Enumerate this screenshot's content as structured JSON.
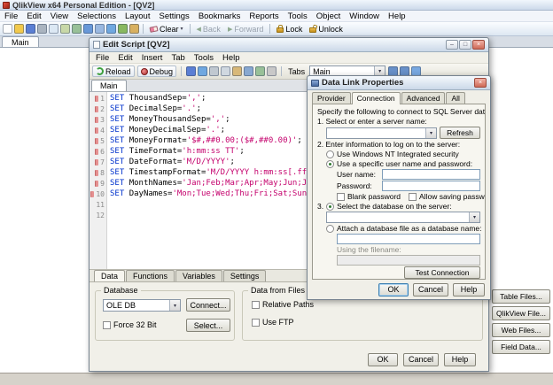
{
  "app": {
    "title": "QlikView x64 Personal Edition - [QV2]",
    "menu": [
      "File",
      "Edit",
      "View",
      "Selections",
      "Layout",
      "Settings",
      "Bookmarks",
      "Reports",
      "Tools",
      "Object",
      "Window",
      "Help"
    ],
    "toolbar": {
      "icons": [
        {
          "name": "new-file-icon",
          "color": "#fdfdfd"
        },
        {
          "name": "open-icon",
          "color": "#f2c94c"
        },
        {
          "name": "save-icon",
          "color": "#5b7fd4"
        },
        {
          "name": "print-icon",
          "color": "#aab4c0"
        },
        {
          "name": "print-preview-icon",
          "color": "#dce8f4"
        },
        {
          "name": "edit-script-icon",
          "color": "#c8d8a8"
        },
        {
          "name": "table-viewer-icon",
          "color": "#98c098"
        },
        {
          "name": "undo-icon",
          "color": "#6898d8"
        },
        {
          "name": "redo-icon",
          "color": "#9ab8e0"
        },
        {
          "name": "search-icon",
          "color": "#70a8e0"
        },
        {
          "name": "current-selections-icon",
          "color": "#88b860"
        },
        {
          "name": "bookmark-icon",
          "color": "#d8b060"
        }
      ],
      "clear_label": "Clear",
      "back_label": "Back",
      "forward_label": "Forward",
      "lock_label": "Lock",
      "unlock_label": "Unlock"
    },
    "sheet_tab": "Main"
  },
  "edit_script": {
    "title": "Edit Script [QV2]",
    "menu": [
      "File",
      "Edit",
      "Insert",
      "Tab",
      "Tools",
      "Help"
    ],
    "toolbar": {
      "reload_label": "Reload",
      "debug_label": "Debug",
      "icons": [
        {
          "name": "save-icon",
          "color": "#5b7fd4"
        },
        {
          "name": "search-icon",
          "color": "#70a8e0"
        },
        {
          "name": "cut-icon",
          "color": "#c0c8d0"
        },
        {
          "name": "copy-icon",
          "color": "#d0d8e0"
        },
        {
          "name": "paste-icon",
          "color": "#d8b878"
        },
        {
          "name": "find-replace-icon",
          "color": "#88a8d0"
        },
        {
          "name": "syntax-check-icon",
          "color": "#98c098"
        },
        {
          "name": "comment-icon",
          "color": "#c8c8c8"
        }
      ],
      "tabs_label": "Tabs",
      "tab_combo_value": "Main",
      "right_icons": [
        {
          "name": "promote-tab-icon",
          "color": "#6890c8"
        },
        {
          "name": "demote-tab-icon",
          "color": "#6890c8"
        },
        {
          "name": "help-icon",
          "color": "#78a8e0"
        }
      ]
    },
    "script_tab": "Main",
    "editor": {
      "line_count": 12,
      "lines": [
        [
          [
            "kw",
            "SET "
          ],
          [
            "id",
            "ThousandSep"
          ],
          [
            "op",
            "="
          ],
          [
            "str",
            "','"
          ],
          [
            "pn",
            ";"
          ]
        ],
        [
          [
            "kw",
            "SET "
          ],
          [
            "id",
            "DecimalSep"
          ],
          [
            "op",
            "="
          ],
          [
            "str",
            "'.'"
          ],
          [
            "pn",
            ";"
          ]
        ],
        [
          [
            "kw",
            "SET "
          ],
          [
            "id",
            "MoneyThousandSep"
          ],
          [
            "op",
            "="
          ],
          [
            "str",
            "','"
          ],
          [
            "pn",
            ";"
          ]
        ],
        [
          [
            "kw",
            "SET "
          ],
          [
            "id",
            "MoneyDecimalSep"
          ],
          [
            "op",
            "="
          ],
          [
            "str",
            "'.'"
          ],
          [
            "pn",
            ";"
          ]
        ],
        [
          [
            "kw",
            "SET "
          ],
          [
            "id",
            "MoneyFormat"
          ],
          [
            "op",
            "="
          ],
          [
            "str",
            "'$#,##0.00;($#,##0.00)'"
          ],
          [
            "pn",
            ";"
          ]
        ],
        [
          [
            "kw",
            "SET "
          ],
          [
            "id",
            "TimeFormat"
          ],
          [
            "op",
            "="
          ],
          [
            "str",
            "'h:mm:ss TT'"
          ],
          [
            "pn",
            ";"
          ]
        ],
        [
          [
            "kw",
            "SET "
          ],
          [
            "id",
            "DateFormat"
          ],
          [
            "op",
            "="
          ],
          [
            "str",
            "'M/D/YYYY'"
          ],
          [
            "pn",
            ";"
          ]
        ],
        [
          [
            "kw",
            "SET "
          ],
          [
            "id",
            "TimestampFormat"
          ],
          [
            "op",
            "="
          ],
          [
            "str",
            "'M/D/YYYY h:mm:ss[.fff] TT'"
          ],
          [
            "pn",
            ";"
          ]
        ],
        [
          [
            "kw",
            "SET "
          ],
          [
            "id",
            "MonthNames"
          ],
          [
            "op",
            "="
          ],
          [
            "str",
            "'Jan;Feb;Mar;Apr;May;Jun;Jul;Aug;Sep;Oct;Nov;Dec'"
          ],
          [
            "pn",
            ";"
          ]
        ],
        [
          [
            "kw",
            "SET "
          ],
          [
            "id",
            "DayNames"
          ],
          [
            "op",
            "="
          ],
          [
            "str",
            "'Mon;Tue;Wed;Thu;Fri;Sat;Sun'"
          ],
          [
            "pn",
            ";"
          ]
        ]
      ]
    },
    "pane_tabs": [
      "Data",
      "Functions",
      "Variables",
      "Settings"
    ],
    "data_tab": {
      "database_group": {
        "label": "Database",
        "combo_value": "OLE DB",
        "connect_label": "Connect...",
        "force32_label": "Force 32 Bit",
        "select_label": "Select..."
      },
      "files_group": {
        "label": "Data from Files",
        "relative_paths_label": "Relative Paths",
        "use_ftp_label": "Use FTP"
      },
      "file_buttons": [
        "Table Files...",
        "QlikView File...",
        "Web Files...",
        "Field Data..."
      ]
    },
    "buttons": {
      "ok": "OK",
      "cancel": "Cancel",
      "help": "Help"
    }
  },
  "data_link": {
    "title": "Data Link Properties",
    "tabs": [
      "Provider",
      "Connection",
      "Advanced",
      "All"
    ],
    "intro": "Specify the following to connect to SQL Server data:",
    "section1": "1. Select or enter a server name:",
    "server_combo_value": "",
    "refresh_label": "Refresh",
    "section2": "2. Enter information to log on to the server:",
    "radio_nt": "Use Windows NT Integrated security",
    "radio_specific": "Use a specific user name and password:",
    "user_name_label": "User name:",
    "user_name_value": "",
    "password_label": "Password:",
    "password_value": "",
    "blank_password_label": "Blank password",
    "allow_saving_label": "Allow saving password",
    "section3_prefix": "3.",
    "radio_select_db": "Select the database on the server:",
    "db_combo_value": "",
    "radio_attach": "Attach a database file as a database name:",
    "attach_value": "",
    "using_filename_label": "Using the filename:",
    "filename_value": "",
    "test_connection_label": "Test Connection",
    "buttons": {
      "ok": "OK",
      "cancel": "Cancel",
      "help": "Help"
    }
  }
}
